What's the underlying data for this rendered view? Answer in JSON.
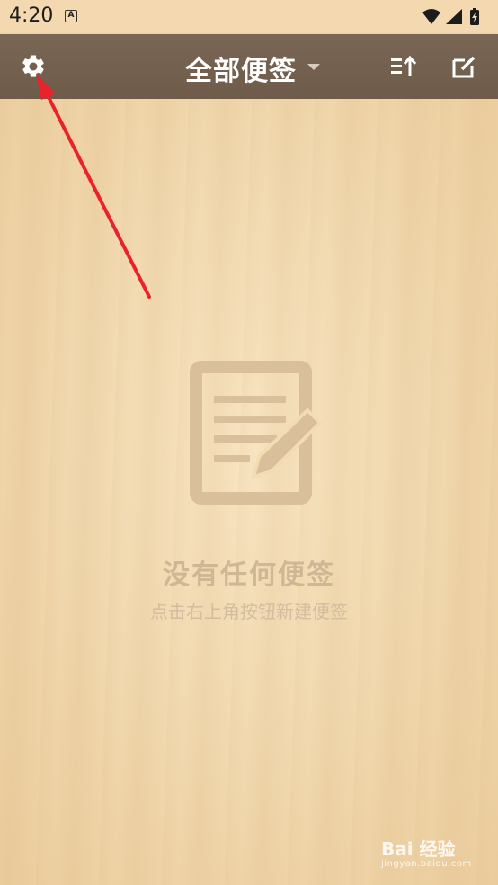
{
  "status_bar": {
    "time": "4:20",
    "app_icon_letter": "A",
    "icons": [
      "wifi-icon",
      "signal-icon",
      "battery-icon"
    ]
  },
  "toolbar": {
    "title": "全部便签",
    "left_icon": "gear-icon",
    "right_icons": [
      "sort-icon",
      "new-note-icon"
    ]
  },
  "empty_state": {
    "icon": "note-edit-icon",
    "title": "没有任何便签",
    "subtitle": "点击右上角按钮新建便签"
  },
  "annotation": {
    "arrow_color": "#e8232b"
  },
  "watermark": {
    "main": "Bai 经验",
    "sub": "jingyan.baidu.com"
  },
  "colors": {
    "toolbar_bg": "#735f4e",
    "wood_bg": "#f3dcb2",
    "empty_text": "#cfb796"
  }
}
